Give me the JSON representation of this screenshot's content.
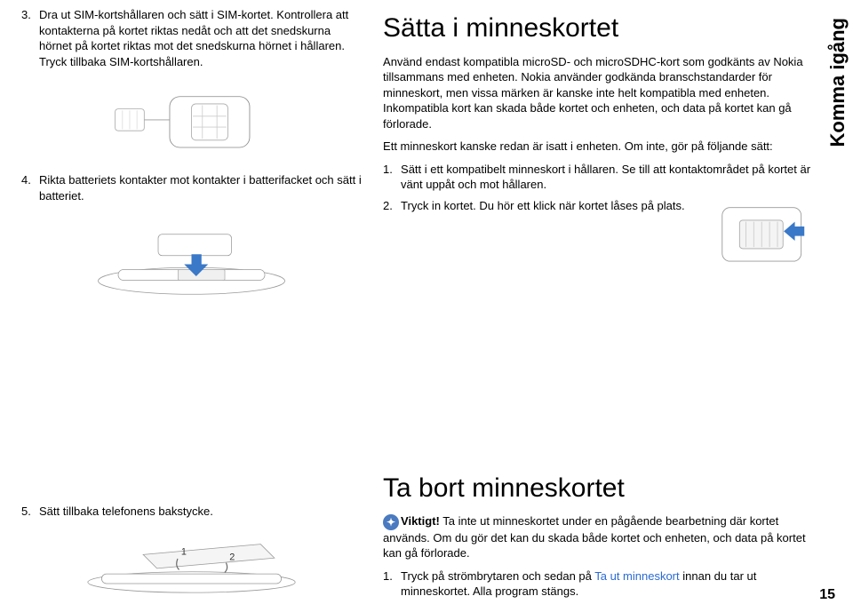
{
  "side_label": "Komma igång",
  "page_number": "15",
  "left": {
    "item3_num": "3.",
    "item3": "Dra ut SIM-kortshållaren och sätt i SIM-kortet. Kontrollera att kontakterna på kortet riktas nedåt och att det snedskurna hörnet på kortet riktas mot det snedskurna hörnet i hållaren. Tryck tillbaka SIM-kortshållaren.",
    "item4_num": "4.",
    "item4": "Rikta batteriets kontakter mot kontakter i batterifacket och sätt i batteriet.",
    "item5_num": "5.",
    "item5": "Sätt tillbaka telefonens bakstycke."
  },
  "right": {
    "h1a": "Sätta i minneskortet",
    "p1": "Använd endast kompatibla microSD- och microSDHC-kort som godkänts av Nokia tillsammans med enheten. Nokia använder godkända branschstandarder för minneskort, men vissa märken är kanske inte helt kompatibla med enheten. Inkompatibla kort kan skada både kortet och enheten, och data på kortet kan gå förlorade.",
    "p2": "Ett minneskort kanske redan är isatt i enheten. Om inte, gör på följande sätt:",
    "li1_num": "1.",
    "li1": "Sätt i ett kompatibelt minneskort i hållaren. Se till att kontaktområdet på kortet är vänt uppåt och mot hållaren.",
    "li2_num": "2.",
    "li2": "Tryck in kortet. Du hör ett klick när kortet låses på plats.",
    "h1b": "Ta bort minneskortet",
    "important_label": "Viktigt!",
    "p3": " Ta inte ut minneskortet under en pågående bearbetning där kortet används. Om du gör det kan du skada både kortet och enheten, och data på kortet kan gå förlorade.",
    "li3_num": "1.",
    "li3a": "Tryck på strömbrytaren och sedan på ",
    "li3link": "Ta ut minneskort",
    "li3b": " innan du tar ut minneskortet. Alla program stängs."
  }
}
